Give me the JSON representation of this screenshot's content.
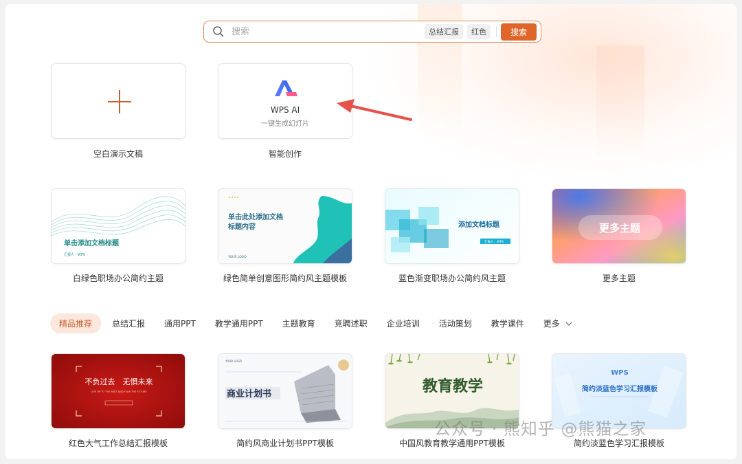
{
  "search": {
    "placeholder": "搜索",
    "chips": [
      "总结汇报",
      "红色"
    ],
    "button": "搜索"
  },
  "create": {
    "blank_label": "空白演示文稿",
    "ai_title": "WPS AI",
    "ai_subtitle": "一键生成幻灯片",
    "ai_label": "智能创作"
  },
  "themes": [
    {
      "label": "白绿色职场办公简约主题",
      "thumb_title": "单击添加文档标题",
      "thumb_sub": "汇报人 · WPS"
    },
    {
      "label": "绿色简单创意图形简约风主题模板",
      "thumb_title": "单击此处添加文档\n标题内容",
      "thumb_sub": "YOUR LOGO"
    },
    {
      "label": "蓝色渐变职场办公简约风主题",
      "thumb_title": "添加文档标题",
      "thumb_sub": "汇报人：WPS"
    },
    {
      "label": "更多主题",
      "thumb_title": "更多主题"
    }
  ],
  "tabs": [
    "精品推荐",
    "总结汇报",
    "通用PPT",
    "教学通用PPT",
    "主题教育",
    "竞聘述职",
    "企业培训",
    "活动策划",
    "教学课件",
    "更多"
  ],
  "templates": [
    {
      "label": "红色大气工作总结汇报模板",
      "thumb_title": "不负过去　无惧未来",
      "thumb_sub": "LIVE UP TO THE PAST AND FEAR THE FUTURE"
    },
    {
      "label": "简约风商业计划书PPT模板",
      "thumb_title": "商业计划书",
      "thumb_sub": "YOUR LOGO"
    },
    {
      "label": "中国风教育教学通用PPT模板",
      "thumb_title": "教育教学"
    },
    {
      "label": "简约淡蓝色学习汇报模板",
      "thumb_title": "简约淡蓝色学习汇报模板",
      "thumb_logo": "WPS"
    }
  ],
  "watermark": "公众号 · 熊知乎 @熊猫之家",
  "colors": {
    "accent": "#e0652a",
    "accent_light": "#fbe7dc",
    "arrow": "#e5524a"
  }
}
